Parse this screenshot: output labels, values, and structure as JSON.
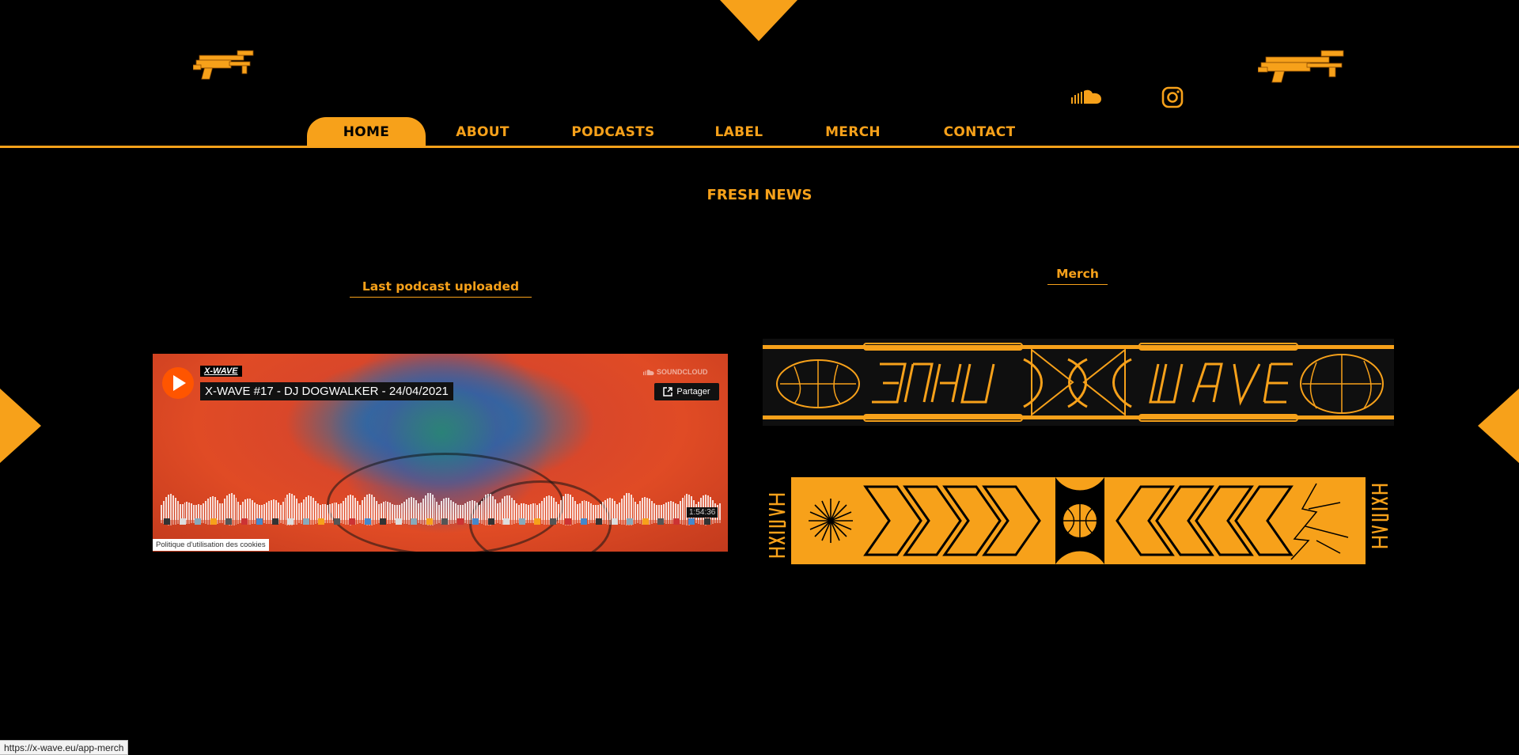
{
  "brand": {
    "accent": "#f7a11a",
    "background": "#000000",
    "soundcloud_orange": "#ff5500"
  },
  "header": {
    "logo_left_icon": "xwave-gun-logo",
    "logo_right_icon": "xwave-gun-logo",
    "social": [
      {
        "icon": "soundcloud-icon"
      },
      {
        "icon": "instagram-icon"
      }
    ]
  },
  "nav": {
    "items": [
      {
        "label": "HOME",
        "active": true
      },
      {
        "label": "ABOUT",
        "active": false
      },
      {
        "label": "PODCASTS",
        "active": false
      },
      {
        "label": "LABEL",
        "active": false
      },
      {
        "label": "MERCH",
        "active": false
      },
      {
        "label": "CONTACT",
        "active": false
      }
    ]
  },
  "main": {
    "title": "FRESH NEWS",
    "podcast_heading": "Last podcast uploaded",
    "merch_heading": "Merch"
  },
  "player": {
    "user": "X-WAVE",
    "track": "X-WAVE #17 - DJ DOGWALKER - 24/04/2021",
    "brand": "SOUNDCLOUD",
    "share_label": "Partager",
    "duration": "1:54:36",
    "cookie_label": "Politique d'utilisation des cookies"
  },
  "merch": {
    "banner_1_text": [
      "X-WAVE",
      "X-WAVE"
    ],
    "banner_2_text": [
      "X-WAVE",
      "X-WAVE"
    ]
  },
  "status_bar": {
    "url": "https://x-wave.eu/app-merch"
  }
}
